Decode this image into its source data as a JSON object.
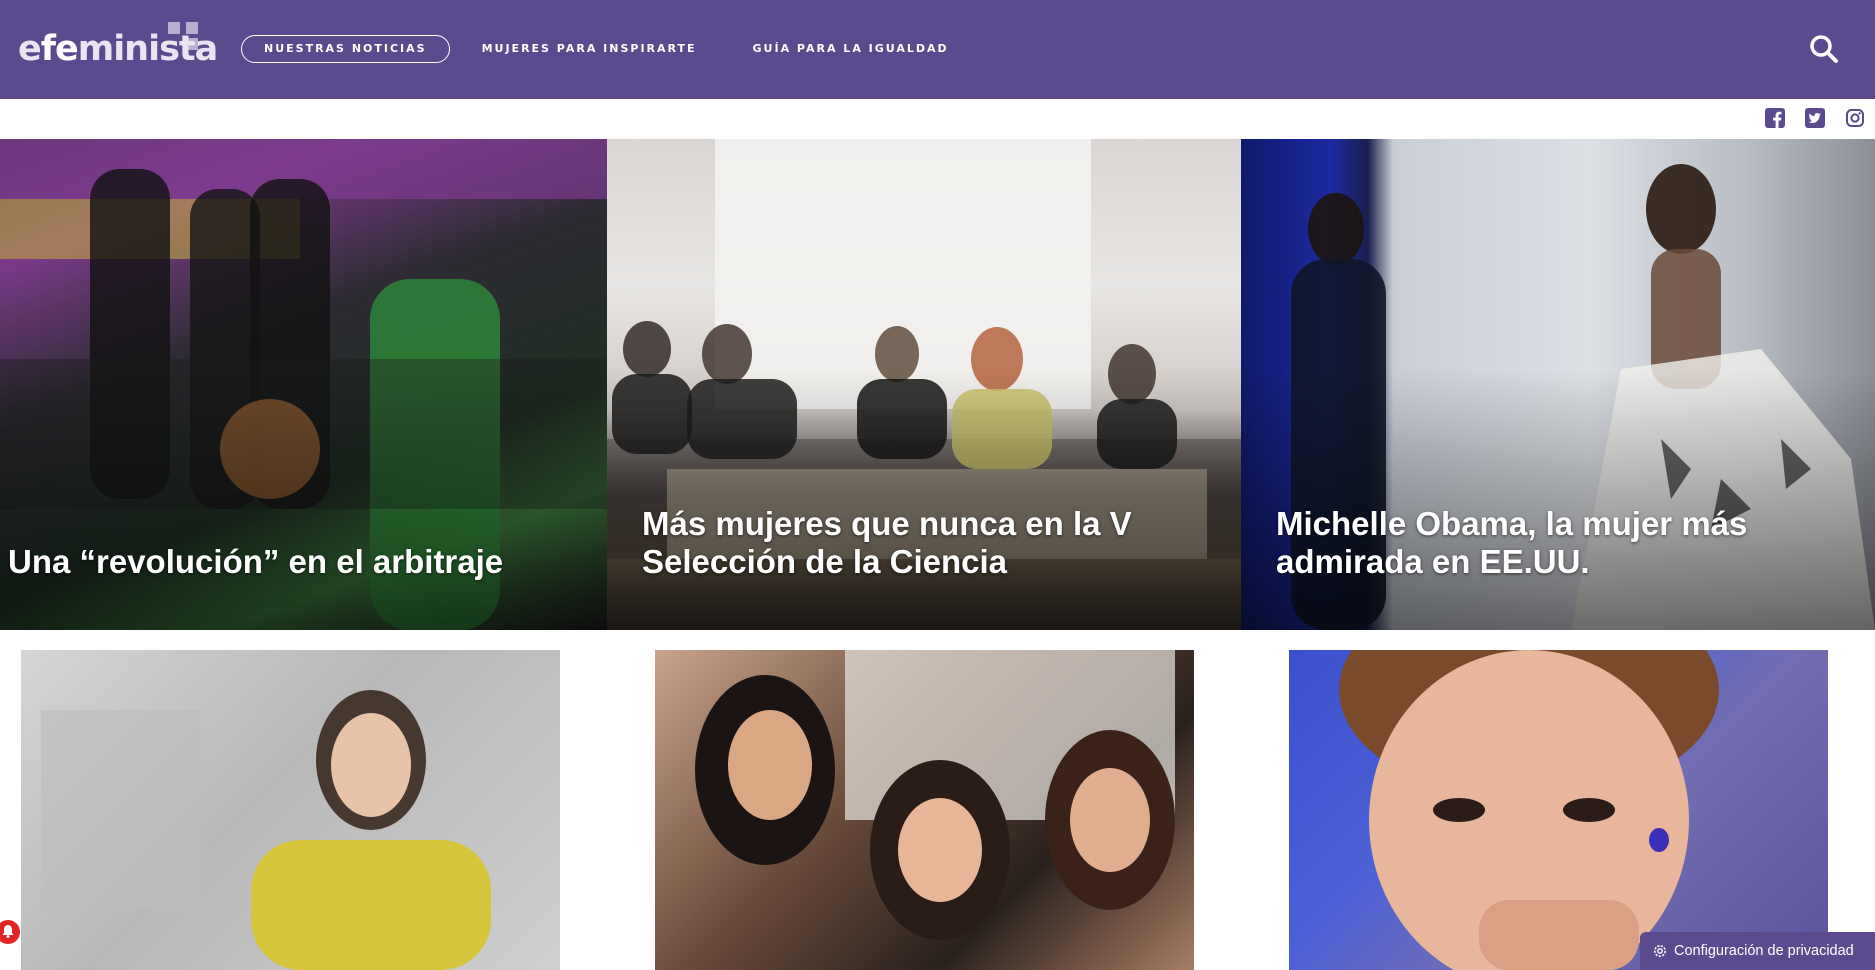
{
  "brand": {
    "logo_prefix": "e",
    "logo_fe": "fe",
    "logo_suffix": "minista",
    "primary_color": "#5c4a8f"
  },
  "nav": {
    "items": [
      {
        "label": "NUESTRAS NOTICIAS",
        "active": true
      },
      {
        "label": "MUJERES PARA INSPIRARTE",
        "active": false
      },
      {
        "label": "GUÍA PARA LA IGUALDAD",
        "active": false
      }
    ],
    "search_icon": "search-icon"
  },
  "social": [
    "facebook-icon",
    "twitter-icon",
    "instagram-icon"
  ],
  "hero": [
    {
      "title": "Una “revolución” en el arbitraje"
    },
    {
      "title": "Más mujeres que nunca en la V Selección de la Ciencia"
    },
    {
      "title": "Michelle Obama, la mujer más admirada en EE.UU."
    }
  ],
  "cards": [
    {
      "image": "woman-in-yellow-top-photo"
    },
    {
      "image": "three-women-portrait-photo"
    },
    {
      "image": "woman-hand-on-chin-photo"
    }
  ],
  "privacy": {
    "label": "Configuración de privacidad",
    "icon": "gear-icon"
  },
  "notification": {
    "icon": "bell-icon",
    "color": "#e02424"
  }
}
